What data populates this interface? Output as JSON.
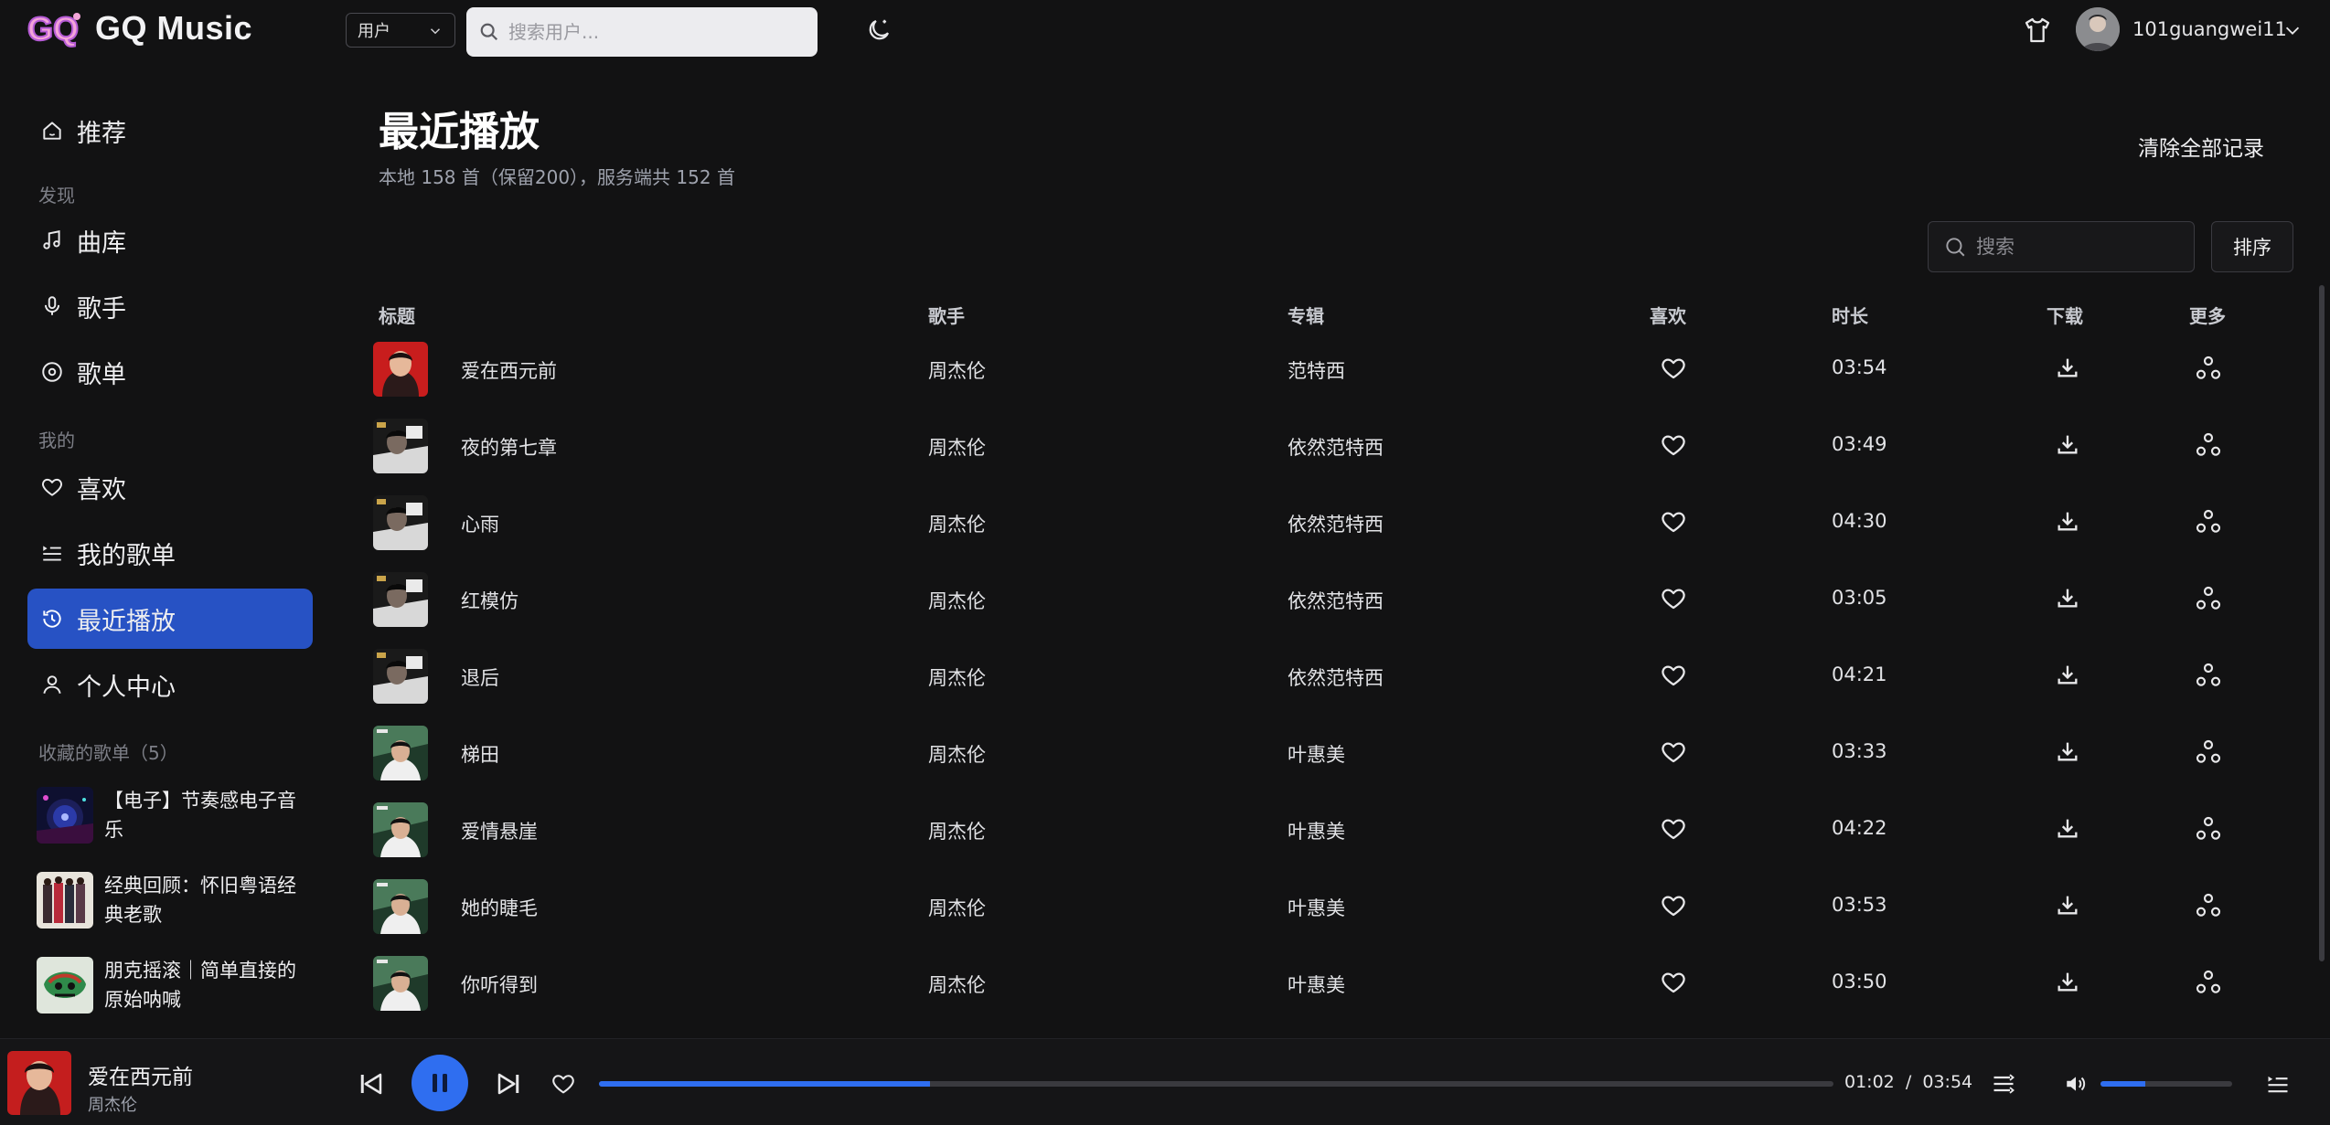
{
  "app": {
    "name": "GQ Music",
    "logo_text": "GQ"
  },
  "topbar": {
    "search_type": "用户",
    "search_placeholder": "搜索用户...",
    "username": "101guangwei11"
  },
  "sidebar": {
    "home_label": "推荐",
    "discover_section": "发现",
    "discover_items": [
      {
        "label": "曲库",
        "icon": "music-note-icon"
      },
      {
        "label": "歌手",
        "icon": "microphone-icon"
      },
      {
        "label": "歌单",
        "icon": "disc-icon"
      }
    ],
    "mine_section": "我的",
    "mine_items": [
      {
        "label": "喜欢",
        "icon": "heart-icon"
      },
      {
        "label": "我的歌单",
        "icon": "playlist-icon"
      },
      {
        "label": "最近播放",
        "icon": "history-icon",
        "active": true
      },
      {
        "label": "个人中心",
        "icon": "user-icon"
      }
    ],
    "favorites_section": "收藏的歌单（5）",
    "favorites": [
      {
        "title": "【电子】节奏感电子音乐",
        "cover": "turntable"
      },
      {
        "title": "经典回顾：怀旧粤语经典老歌",
        "cover": "band-photo"
      },
      {
        "title": "朋克摇滚｜简单直接的原始呐喊",
        "cover": "graffiti"
      }
    ]
  },
  "main": {
    "title": "最近播放",
    "subtitle": "本地 158 首（保留200），服务端共 152 首",
    "clear_label": "清除全部记录",
    "search_placeholder": "搜索",
    "sort_label": "排序",
    "columns": {
      "title": "标题",
      "artist": "歌手",
      "album": "专辑",
      "like": "喜欢",
      "duration": "时长",
      "download": "下载",
      "more": "更多"
    },
    "rows": [
      {
        "title": "爱在西元前",
        "artist": "周杰伦",
        "album": "范特西",
        "duration": "03:54",
        "cover": "fantasy"
      },
      {
        "title": "夜的第七章",
        "artist": "周杰伦",
        "album": "依然范特西",
        "duration": "03:49",
        "cover": "still-fantasy"
      },
      {
        "title": "心雨",
        "artist": "周杰伦",
        "album": "依然范特西",
        "duration": "04:30",
        "cover": "still-fantasy"
      },
      {
        "title": "红模仿",
        "artist": "周杰伦",
        "album": "依然范特西",
        "duration": "03:05",
        "cover": "still-fantasy"
      },
      {
        "title": "退后",
        "artist": "周杰伦",
        "album": "依然范特西",
        "duration": "04:21",
        "cover": "still-fantasy"
      },
      {
        "title": "梯田",
        "artist": "周杰伦",
        "album": "叶惠美",
        "duration": "03:33",
        "cover": "yehuimei"
      },
      {
        "title": "爱情悬崖",
        "artist": "周杰伦",
        "album": "叶惠美",
        "duration": "04:22",
        "cover": "yehuimei"
      },
      {
        "title": "她的睫毛",
        "artist": "周杰伦",
        "album": "叶惠美",
        "duration": "03:53",
        "cover": "yehuimei"
      },
      {
        "title": "你听得到",
        "artist": "周杰伦",
        "album": "叶惠美",
        "duration": "03:50",
        "cover": "yehuimei"
      }
    ]
  },
  "player": {
    "title": "爱在西元前",
    "artist": "周杰伦",
    "current_time": "01:02",
    "separator": "/",
    "total_time": "03:54",
    "progress_fraction": 0.268,
    "volume_fraction": 0.34,
    "playing": true
  },
  "colors": {
    "accent": "#2f6ef0",
    "active_nav": "#2752c4",
    "background": "#121213"
  }
}
